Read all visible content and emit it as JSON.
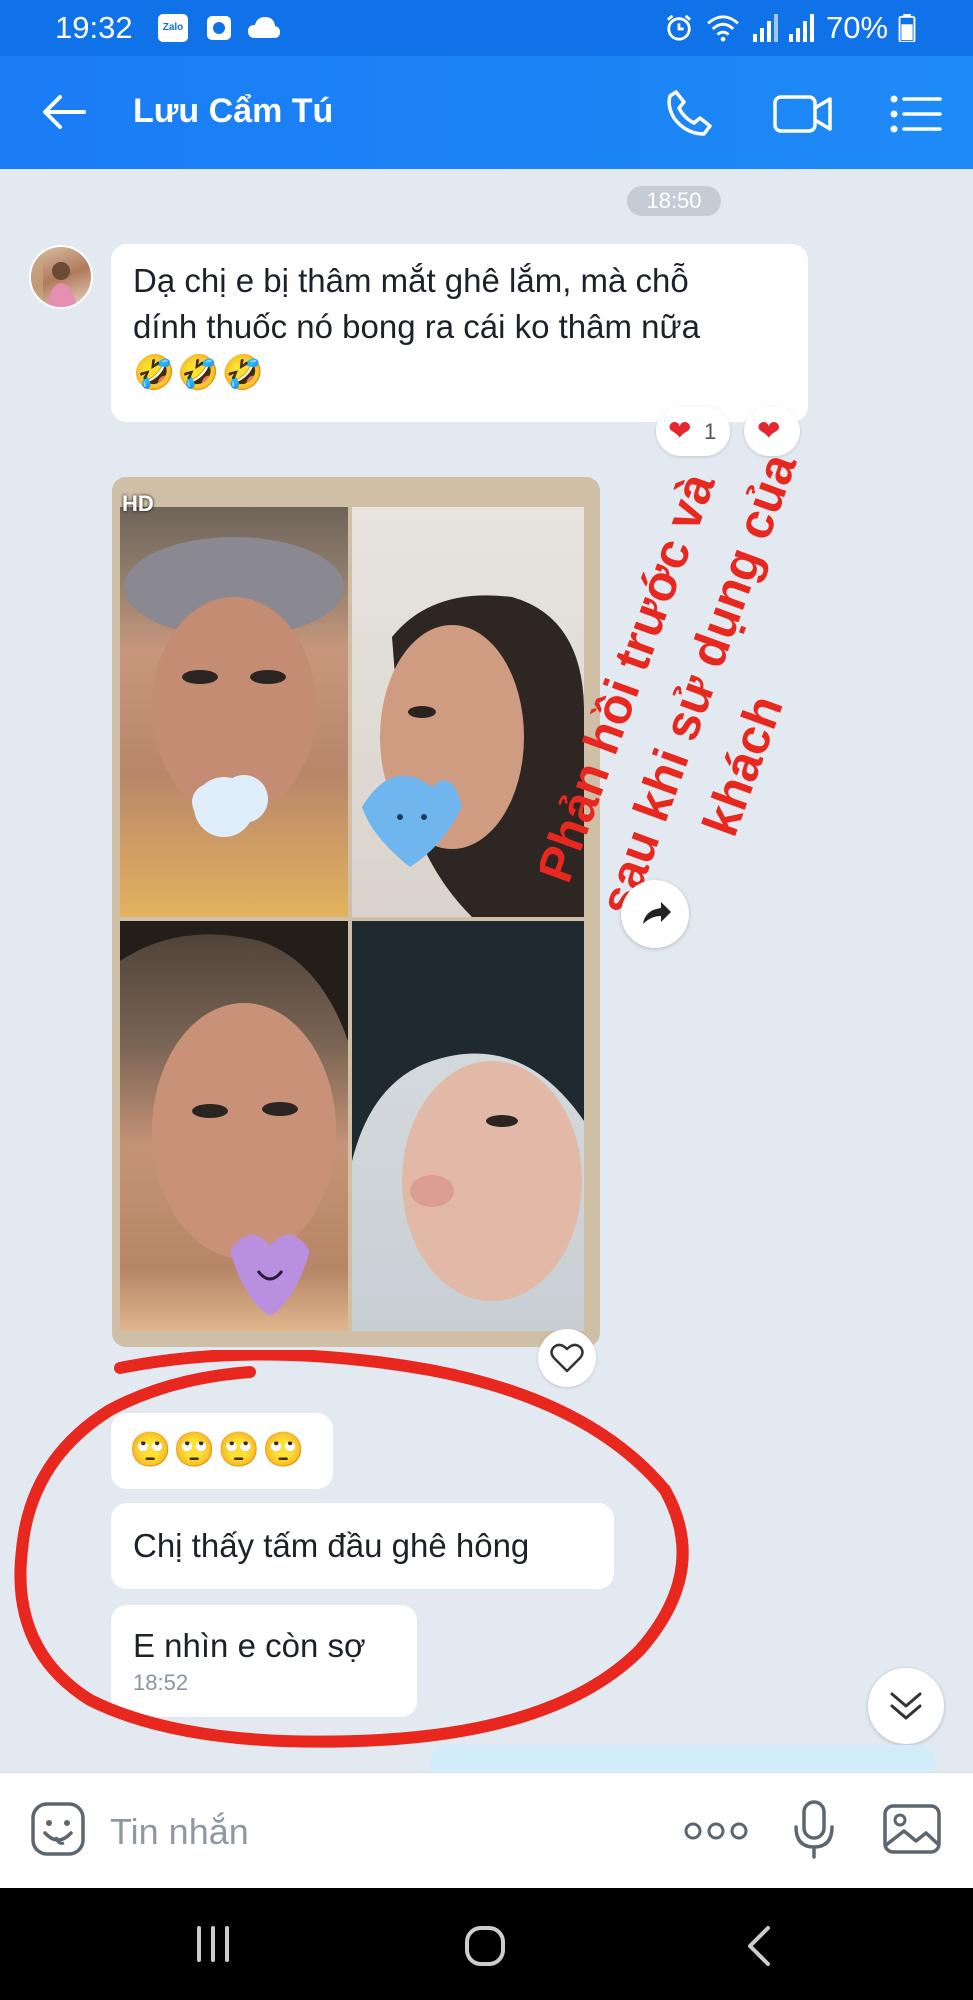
{
  "status_bar": {
    "time": "19:32",
    "battery": "70%",
    "zalo_label": "Zalo"
  },
  "header": {
    "contact_name": "Lưu Cẩm Tú"
  },
  "chat": {
    "time_separator": "18:50",
    "message_1": {
      "line1": "Dạ chị e bị thâm mắt ghê lắm, mà chỗ",
      "line2": "dính thuốc nó bong ra cái ko thâm nữa",
      "emojis": "🤣🤣🤣",
      "reaction_count": "1"
    },
    "photo_badge": "HD",
    "message_2": {
      "emojis": "🙄🙄🙄🙄"
    },
    "message_3": {
      "text": "Chị thấy tấm đầu ghê hông"
    },
    "message_4": {
      "text": "E nhìn e còn sợ",
      "time": "18:52"
    }
  },
  "overlay": {
    "line1": "Phản hồi trước và",
    "line2": "sau khi sử dụng của",
    "line3": "khách",
    "color": "#e8281e"
  },
  "input": {
    "placeholder": "Tin nhắn"
  },
  "colors": {
    "header_blue": "#1a7cf5",
    "chat_bg": "#e2e9f1",
    "annotation_red": "#e8281e"
  }
}
